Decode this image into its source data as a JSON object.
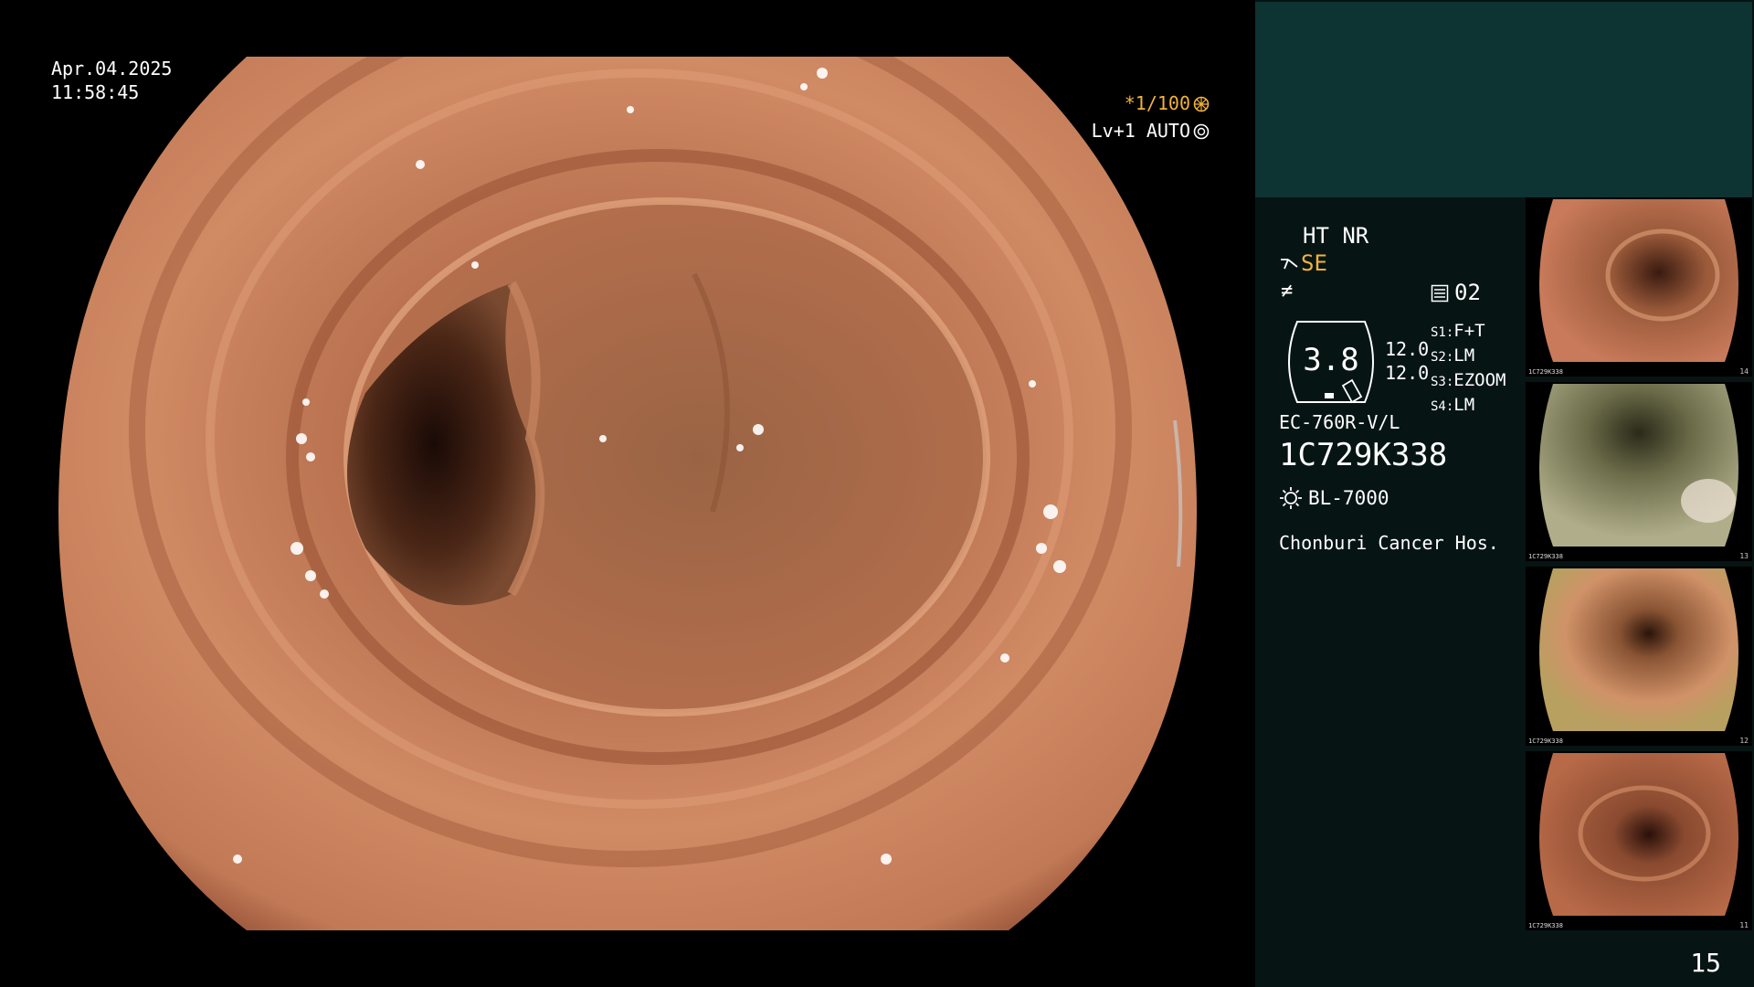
{
  "overlay": {
    "date": "Apr.04.2025",
    "time": "11:58:45",
    "shutter": "*1/100",
    "level": "Lv+1 AUTO"
  },
  "panel": {
    "mode": "HT NR",
    "se": "SE",
    "f_symbol": "≠",
    "preset": "02",
    "gauge_value": "3.8",
    "value_1": "12.0",
    "value_2": "12.0",
    "switches": [
      {
        "label": "S1:",
        "value": "F+T"
      },
      {
        "label": "S2:",
        "value": "LM"
      },
      {
        "label": "S3:",
        "value": "EZOOM"
      },
      {
        "label": "S4:",
        "value": "LM"
      }
    ],
    "scope_model": "EC-760R-V/L",
    "scope_serial": "1C729K338",
    "light_source": "BL-7000",
    "hospital": "Chonburi Cancer Hos."
  },
  "thumbnails": [
    {
      "number": "14",
      "tint": "#c87a5a",
      "dark": "#3a1a10"
    },
    {
      "number": "13",
      "tint": "#8a8a62",
      "dark": "#2a2a1a"
    },
    {
      "number": "12",
      "tint": "#c8845a",
      "dark": "#2a140a"
    },
    {
      "number": "11",
      "tint": "#b86a48",
      "dark": "#2a100a"
    }
  ],
  "thumb_serial": "1C729K338",
  "page_number": "15"
}
